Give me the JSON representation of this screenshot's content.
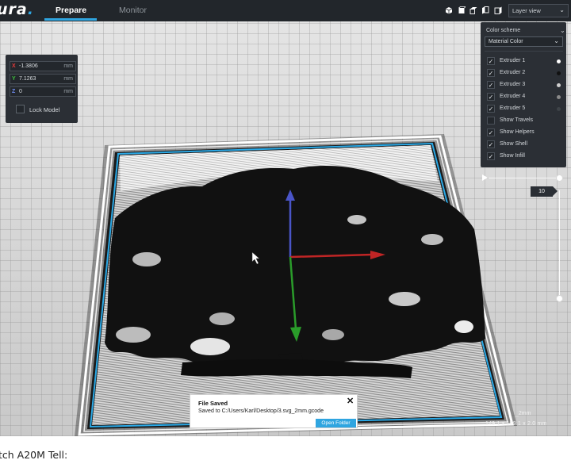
{
  "app": {
    "logo_text": "ura",
    "logo_dot": "."
  },
  "header": {
    "tabs": [
      {
        "label": "Prepare",
        "active": true
      },
      {
        "label": "Monitor",
        "active": false
      }
    ],
    "view_icons": [
      "3d-view-icon",
      "front-view-icon",
      "top-view-icon",
      "left-view-icon",
      "right-view-icon"
    ],
    "view_mode": "Layer view"
  },
  "position_panel": {
    "x": {
      "axis": "X",
      "value": "-1.3806",
      "unit": "mm",
      "color": "#e33b3b"
    },
    "y": {
      "axis": "Y",
      "value": "7.1263",
      "unit": "mm",
      "color": "#3fbf3f"
    },
    "z": {
      "axis": "Z",
      "value": "0",
      "unit": "mm",
      "color": "#4b6fe0"
    },
    "lock_label": "Lock Model"
  },
  "color_panel": {
    "title": "Color scheme",
    "selected_scheme": "Material Color",
    "items": [
      {
        "label": "Extruder 1",
        "checked": true,
        "dot": "#ffffff"
      },
      {
        "label": "Extruder 2",
        "checked": true,
        "dot": "#111111"
      },
      {
        "label": "Extruder 3",
        "checked": true,
        "dot": "#cfcfcf"
      },
      {
        "label": "Extruder 4",
        "checked": true,
        "dot": "#8a8a8a"
      },
      {
        "label": "Extruder 5",
        "checked": true,
        "dot": "#3e4348"
      },
      {
        "label": "Show Travels",
        "checked": false
      },
      {
        "label": "Show Helpers",
        "checked": true
      },
      {
        "label": "Show Shell",
        "checked": true
      },
      {
        "label": "Show Infill",
        "checked": true
      }
    ]
  },
  "layer_slider": {
    "current_layer": "10"
  },
  "toast": {
    "title": "File Saved",
    "message": "Saved to C:/Users/Karl/Desktop/3.svg_2mm.gcode",
    "button": "Open Folder"
  },
  "viewport": {
    "file_label": "_2mm",
    "dimensions": "149.1 x 159.1 x 2.0 mm"
  },
  "caption": "tch A20M Tell:"
}
